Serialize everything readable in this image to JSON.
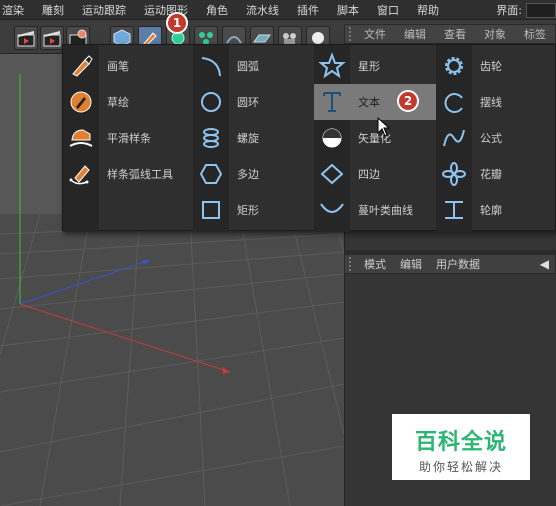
{
  "menubar": {
    "items": [
      "渲染",
      "雕刻",
      "运动跟踪",
      "运动图形",
      "角色",
      "流水线",
      "插件",
      "脚本",
      "窗口",
      "帮助"
    ],
    "layout_label": "界面:"
  },
  "object_manager": {
    "tabs": [
      "文件",
      "编辑",
      "查看",
      "对象",
      "标签"
    ]
  },
  "attribute_manager": {
    "tabs": [
      "模式",
      "编辑",
      "用户数据"
    ]
  },
  "spline_menu": {
    "columns": [
      [
        {
          "label": "画笔",
          "icon": "pen-icon"
        },
        {
          "label": "草绘",
          "icon": "sketch-icon"
        },
        {
          "label": "平滑样条",
          "icon": "smooth-spline-icon"
        },
        {
          "label": "样条弧线工具",
          "icon": "spline-arc-tool-icon"
        }
      ],
      [
        {
          "label": "圆弧",
          "icon": "arc-icon"
        },
        {
          "label": "圆环",
          "icon": "circle-icon"
        },
        {
          "label": "螺旋",
          "icon": "helix-icon"
        },
        {
          "label": "多边",
          "icon": "polygon-icon"
        },
        {
          "label": "矩形",
          "icon": "rectangle-icon"
        }
      ],
      [
        {
          "label": "星形",
          "icon": "star-icon"
        },
        {
          "label": "文本",
          "icon": "text-icon"
        },
        {
          "label": "矢量化",
          "icon": "vectorize-icon"
        },
        {
          "label": "四边",
          "icon": "four-side-icon"
        },
        {
          "label": "蔓叶类曲线",
          "icon": "cissoid-icon"
        }
      ],
      [
        {
          "label": "齿轮",
          "icon": "gear-icon"
        },
        {
          "label": "摆线",
          "icon": "cycloid-icon"
        },
        {
          "label": "公式",
          "icon": "formula-icon"
        },
        {
          "label": "花瓣",
          "icon": "flower-icon"
        },
        {
          "label": "轮廓",
          "icon": "profile-icon"
        }
      ]
    ],
    "highlighted": "文本"
  },
  "badges": [
    "1",
    "2"
  ],
  "watermark": {
    "title": "百科全说",
    "subtitle": "助你轻松解决"
  },
  "colors": {
    "accent": "#5b7da6",
    "icon_blue": "#8ec3f0",
    "badge_red": "#c0392b",
    "watermark_green": "#2bb673"
  }
}
